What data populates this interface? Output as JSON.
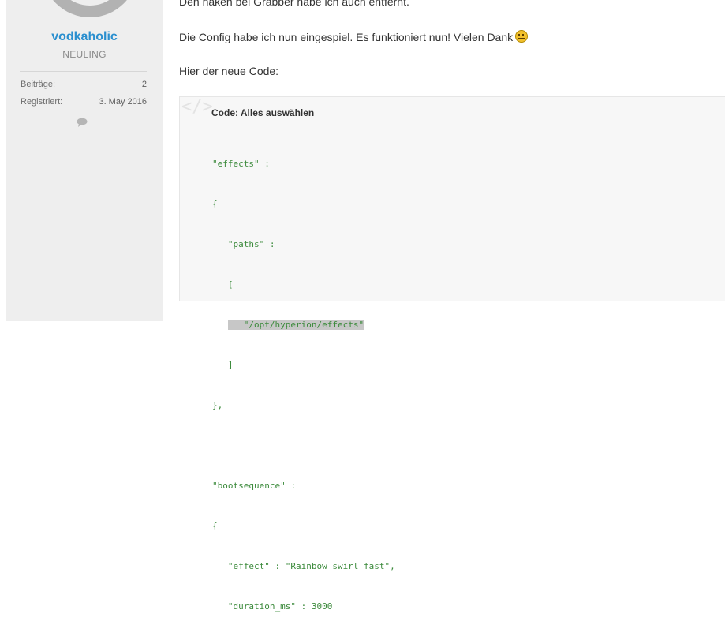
{
  "sidebar": {
    "username": "vodkaholic",
    "rank": "NEULING",
    "stats": [
      {
        "label": "Beiträge:",
        "value": "2"
      },
      {
        "label": "Registriert:",
        "value": "3. May 2016"
      }
    ]
  },
  "post": {
    "paragraph1": "Den haken bei Grabber habe ich auch entfernt.",
    "paragraph2": "Die Config habe ich nun eingespiel. Es funktioniert nun! Vielen Dank",
    "paragraph3": "Hier der neue Code:",
    "code": {
      "title": "Code: Alles auswählen",
      "lines": [
        "\"effects\" :",
        "{",
        "   \"paths\" :",
        "   [",
        "      \"/opt/hyperion/effects\"",
        "   ]",
        "},",
        "",
        "\"bootsequence\" :",
        "{",
        "   \"effect\" : \"Rainbow swirl fast\",",
        "   \"duration_ms\" : 3000"
      ]
    }
  },
  "icons": {
    "code": "code-icon",
    "chat": "chat-icon",
    "smiley": "smiley-icon"
  }
}
